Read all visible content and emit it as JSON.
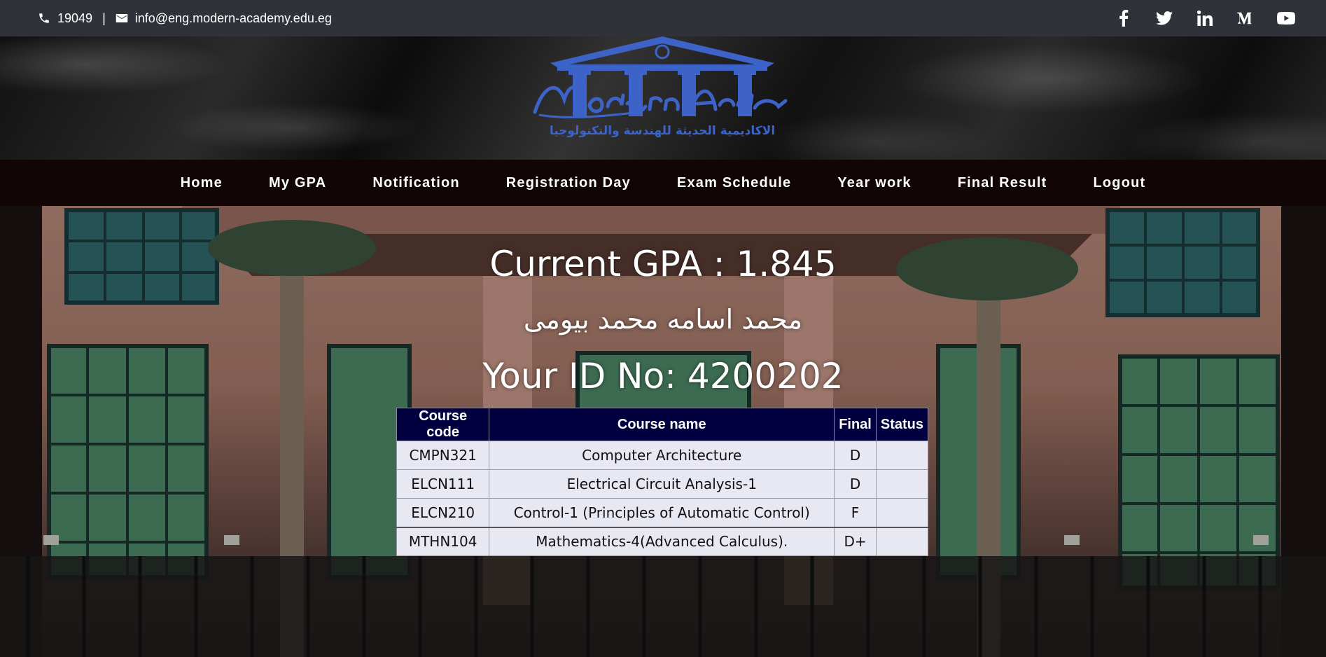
{
  "topbar": {
    "phone": "19049",
    "separator": "|",
    "email": "info@eng.modern-academy.edu.eg",
    "socials": [
      "facebook-icon",
      "twitter-icon",
      "linkedin-icon",
      "medium-icon",
      "youtube-icon"
    ]
  },
  "logo": {
    "text_en": "Modern Academy",
    "text_ar": "الاكاديمية الحديثة للهندسة والتكنولوجيا",
    "color": "#3d63c9"
  },
  "nav": {
    "items": [
      "Home",
      "My GPA",
      "Notification",
      "Registration Day",
      "Exam Schedule",
      "Year work",
      "Final Result",
      "Logout"
    ]
  },
  "student": {
    "gpa_line": "Current GPA : 1.845",
    "name": "محمد اسامه محمد بيومى",
    "id_line": "Your ID No: 4200202"
  },
  "table": {
    "headers": [
      "Course code",
      "Course name",
      "Final",
      "Status"
    ],
    "rows": [
      [
        "CMPN321",
        "Computer Architecture",
        "D",
        ""
      ],
      [
        "ELCN111",
        "Electrical Circuit Analysis-1",
        "D",
        ""
      ],
      [
        "ELCN210",
        "Control-1 (Principles of Automatic Control)",
        "F",
        ""
      ],
      [
        "MTHN104",
        "Mathematics-4(Advanced Calculus).",
        "D+",
        ""
      ]
    ]
  },
  "colors": {
    "topbar_bg": "#2f3339",
    "nav_bg": "#110506",
    "table_header_bg": "#03003f",
    "table_cell_bg": "#e8e8f3"
  }
}
